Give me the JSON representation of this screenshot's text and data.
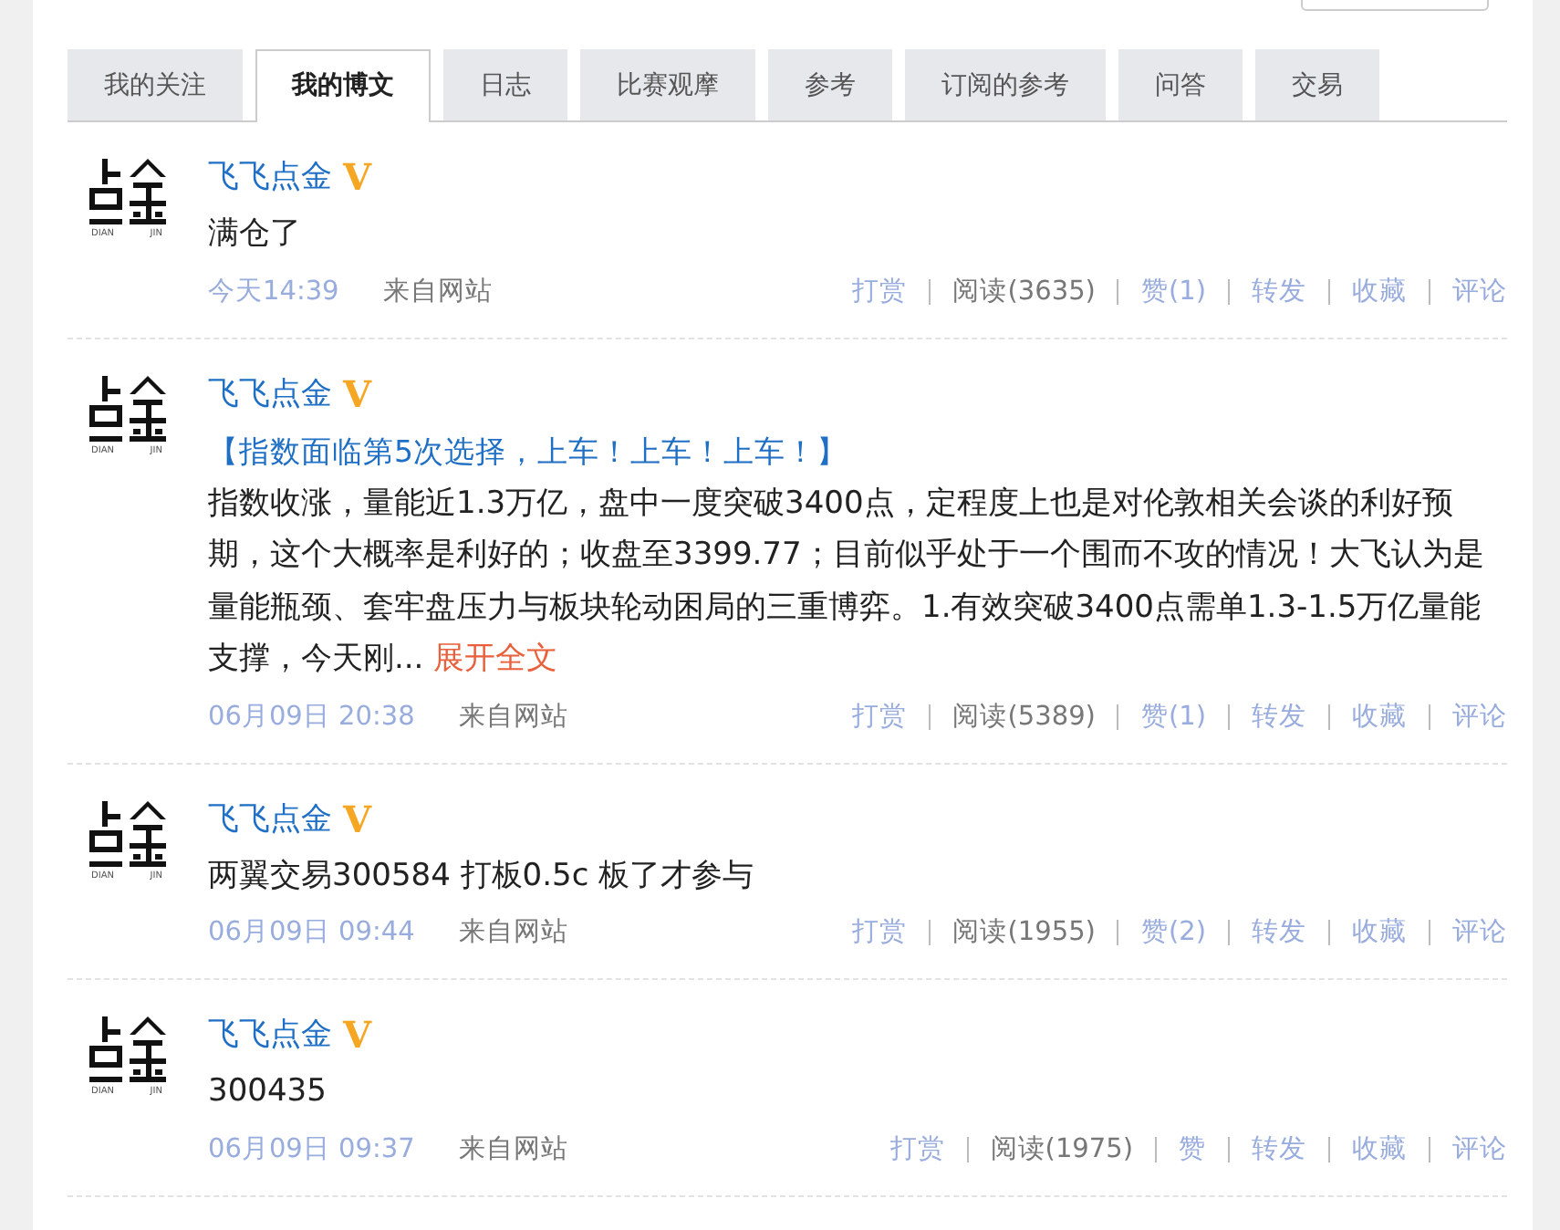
{
  "tabs": [
    {
      "label": "我的关注",
      "selected": false
    },
    {
      "label": "我的博文",
      "selected": true
    },
    {
      "label": "日志",
      "selected": false
    },
    {
      "label": "比赛观摩",
      "selected": false
    },
    {
      "label": "参考",
      "selected": false
    },
    {
      "label": "订阅的参考",
      "selected": false
    },
    {
      "label": "问答",
      "selected": false
    },
    {
      "label": "交易",
      "selected": false
    }
  ],
  "posts": [
    {
      "avatar_caption": [
        "DIAN",
        "JIN"
      ],
      "author": "飞飞点金",
      "badge": "V",
      "content": "满仓了",
      "time": "今天14:39",
      "source": "来自网站",
      "actions": [
        {
          "label": "打赏",
          "kind": "link"
        },
        {
          "label": "阅读(3635)",
          "kind": "count"
        },
        {
          "label": "赞(1)",
          "kind": "link"
        },
        {
          "label": "转发",
          "kind": "link"
        },
        {
          "label": "收藏",
          "kind": "link"
        },
        {
          "label": "评论",
          "kind": "link"
        }
      ]
    },
    {
      "avatar_caption": [
        "DIAN",
        "JIN"
      ],
      "author": "飞飞点金",
      "badge": "V",
      "title": "【指数面临第5次选择，上车！上车！上车！】",
      "content": "指数收涨，量能近1.3万亿，盘中一度突破3400点，定程度上也是对伦敦相关会谈的利好预期，这个大概率是利好的；收盘至3399.77；目前似乎处于一个围而不攻的情况！大飞认为是量能瓶颈、套牢盘压力与板块轮动困局的三重博弈。1.有效突破3400点需单1.3-1.5万亿量能支撑，今天刚...",
      "more": "展开全文",
      "time": "06月09日 20:38",
      "source": "来自网站",
      "actions": [
        {
          "label": "打赏",
          "kind": "link"
        },
        {
          "label": "阅读(5389)",
          "kind": "count"
        },
        {
          "label": "赞(1)",
          "kind": "link"
        },
        {
          "label": "转发",
          "kind": "link"
        },
        {
          "label": "收藏",
          "kind": "link"
        },
        {
          "label": "评论",
          "kind": "link"
        }
      ]
    },
    {
      "avatar_caption": [
        "DIAN",
        "JIN"
      ],
      "author": "飞飞点金",
      "badge": "V",
      "content": "两翼交易300584 打板0.5c 板了才参与",
      "time": "06月09日 09:44",
      "source": "来自网站",
      "actions": [
        {
          "label": "打赏",
          "kind": "link"
        },
        {
          "label": "阅读(1955)",
          "kind": "count"
        },
        {
          "label": "赞(2)",
          "kind": "link"
        },
        {
          "label": "转发",
          "kind": "link"
        },
        {
          "label": "收藏",
          "kind": "link"
        },
        {
          "label": "评论",
          "kind": "link"
        }
      ]
    },
    {
      "avatar_caption": [
        "DIAN",
        "JIN"
      ],
      "author": "飞飞点金",
      "badge": "V",
      "content": "300435",
      "time": "06月09日 09:37",
      "source": "来自网站",
      "actions": [
        {
          "label": "打赏",
          "kind": "link"
        },
        {
          "label": "阅读(1975)",
          "kind": "count"
        },
        {
          "label": "赞",
          "kind": "link"
        },
        {
          "label": "转发",
          "kind": "link"
        },
        {
          "label": "收藏",
          "kind": "link"
        },
        {
          "label": "评论",
          "kind": "link"
        }
      ]
    }
  ]
}
